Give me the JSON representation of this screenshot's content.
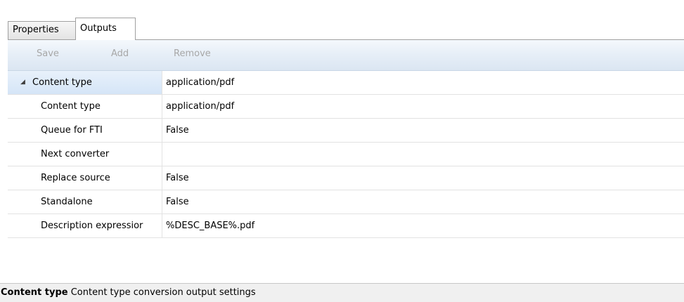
{
  "tabs": [
    {
      "label": "Properties",
      "active": false
    },
    {
      "label": "Outputs",
      "active": true
    }
  ],
  "toolbar": {
    "save_label": "Save",
    "add_label": "Add",
    "remove_label": "Remove",
    "disabled_color": "#a7a7a7"
  },
  "grid": {
    "parent": {
      "name": "Content type",
      "value": "application/pdf",
      "expanded": true,
      "expander_icon": "triangle-expanded"
    },
    "children": [
      {
        "name": "Content type",
        "value": "application/pdf"
      },
      {
        "name": "Queue for FTI",
        "value": "False"
      },
      {
        "name": "Next converter",
        "value": ""
      },
      {
        "name": "Replace source",
        "value": "False"
      },
      {
        "name": "Standalone",
        "value": "False"
      },
      {
        "name": "Description expressior",
        "value": "%DESC_BASE%.pdf"
      }
    ]
  },
  "status": {
    "title": "Content type",
    "description": "Content type conversion output settings"
  },
  "colors": {
    "selection": "#d5e5f7",
    "toolbar": "#e6eef7"
  }
}
